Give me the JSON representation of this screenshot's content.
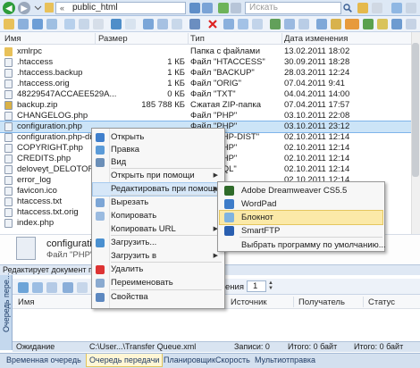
{
  "toolbar": {
    "path": "public_html",
    "search_placeholder": "Искать"
  },
  "columns": {
    "name": "Имя",
    "size": "Размер",
    "type": "Тип",
    "date": "Дата изменения"
  },
  "files": [
    {
      "name": "xmlrpc",
      "size": "",
      "type": "Папка с файлами",
      "date": "13.02.2011 18:02",
      "icon": "folder"
    },
    {
      "name": ".htaccess",
      "size": "1 КБ",
      "type": "Файл \"HTACCESS\"",
      "date": "30.09.2011 18:28",
      "icon": "file"
    },
    {
      "name": ".htaccess.backup",
      "size": "1 КБ",
      "type": "Файл \"BACKUP\"",
      "date": "28.03.2011 12:24",
      "icon": "file"
    },
    {
      "name": ".htaccess.orig",
      "size": "1 КБ",
      "type": "Файл \"ORIG\"",
      "date": "07.04.2011 9:41",
      "icon": "file"
    },
    {
      "name": "48229547ACCAEE529A...",
      "size": "0 КБ",
      "type": "Файл \"TXT\"",
      "date": "04.04.2011 14:00",
      "icon": "file"
    },
    {
      "name": "backup.zip",
      "size": "185 788 КБ",
      "type": "Сжатая ZIP-папка",
      "date": "07.04.2011 17:57",
      "icon": "zip"
    },
    {
      "name": "CHANGELOG.php",
      "size": "",
      "type": "Файл \"PHP\"",
      "date": "03.10.2011 22:08",
      "icon": "file"
    },
    {
      "name": "configuration.php",
      "size": "",
      "type": "Файл \"PHP\"",
      "date": "03.10.2011 23:12",
      "icon": "file",
      "selected": true
    },
    {
      "name": "configuration.php-dist",
      "size": "",
      "type": "Файл \"PHP-DIST\"",
      "date": "02.10.2011 12:14",
      "icon": "file"
    },
    {
      "name": "COPYRIGHT.php",
      "size": "",
      "type": "Файл \"PHP\"",
      "date": "02.10.2011 12:14",
      "icon": "file"
    },
    {
      "name": "CREDITS.php",
      "size": "",
      "type": "Файл \"PHP\"",
      "date": "02.10.2011 12:14",
      "icon": "file"
    },
    {
      "name": "deloveyt_DELOTOR.sql",
      "size": "",
      "type": "Файл \"SQL\"",
      "date": "02.10.2011 12:14",
      "icon": "file"
    },
    {
      "name": "error_log",
      "size": "",
      "type": "",
      "date": "02.10.2011 12:14",
      "icon": "file"
    },
    {
      "name": "favicon.ico",
      "size": "",
      "type": "",
      "date": "02.10.2011 12:14",
      "icon": "file"
    },
    {
      "name": "htaccess.txt",
      "size": "",
      "type": "",
      "date": "02.10.2011 12:14",
      "icon": "file"
    },
    {
      "name": "htaccess.txt.orig",
      "size": "",
      "type": "",
      "date": "02.10.2011 12:14",
      "icon": "file"
    },
    {
      "name": "index.php",
      "size": "",
      "type": "",
      "date": "02.10.2011 12:14",
      "icon": "file"
    }
  ],
  "details": {
    "name": "configuration",
    "type": "Файл \"PHP\""
  },
  "status": "Редактирует документ при с",
  "context_menu": {
    "items": [
      {
        "label": "Открыть",
        "icon": "open-icon"
      },
      {
        "label": "Правка",
        "icon": "edit-icon"
      },
      {
        "label": "Вид",
        "icon": "view-icon"
      },
      {
        "label": "Открыть при помощи",
        "submenu": true
      },
      {
        "label": "Редактировать при помощи",
        "submenu": true,
        "highlighted": true
      },
      {
        "label": "Вырезать",
        "icon": "cut-icon"
      },
      {
        "label": "Копировать",
        "icon": "copy-icon"
      },
      {
        "label": "Копировать URL",
        "submenu": true
      },
      {
        "label": "Загрузить...",
        "icon": "download-icon"
      },
      {
        "label": "Загрузить в",
        "submenu": true
      },
      {
        "label": "Удалить",
        "icon": "delete-icon"
      },
      {
        "label": "Переименовать",
        "icon": "rename-icon"
      },
      {
        "label": "Свойства",
        "icon": "properties-icon"
      }
    ]
  },
  "submenu": {
    "items": [
      {
        "label": "Adobe Dreamweaver CS5.5",
        "icon": "dreamweaver-icon"
      },
      {
        "label": "WordPad",
        "icon": "wordpad-icon"
      },
      {
        "label": "Блокнот",
        "icon": "notepad-icon",
        "highlighted": true
      },
      {
        "label": "SmartFTP",
        "icon": "smartftp-icon"
      },
      {
        "label": "Выбрать программу по умолчанию...",
        "icon": ""
      }
    ]
  },
  "queue": {
    "side_label": "Очередь пере...",
    "pages_label": "ения",
    "pages_value": "1",
    "columns": [
      "Имя",
      "Источник",
      "Получатель",
      "Статус"
    ],
    "status": {
      "state": "Ожидание",
      "file": "C:\\User...\\Transfer Queue.xml",
      "records_label": "Записи: 0",
      "size_label": "Итого: 0 байт",
      "total_label": "Итого: 0 байт"
    },
    "tabs": [
      {
        "label": "Временная очередь"
      },
      {
        "label": "Очередь передачи",
        "active": true
      },
      {
        "label": "Планировщик"
      },
      {
        "label": "Скорость"
      },
      {
        "label": "Мультиотправка"
      }
    ]
  },
  "colors": {
    "selection": "#cce4f7",
    "menu_highlight": "#d6e7f8",
    "submenu_highlight": "#fbe9a8",
    "accent_blue": "#3a76c4"
  }
}
